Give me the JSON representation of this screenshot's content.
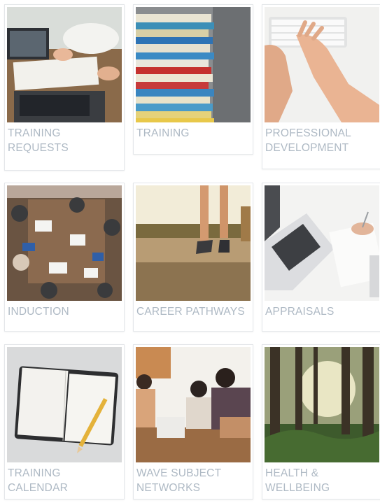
{
  "tiles": [
    {
      "label": "Training\nRequests",
      "image": "laptop-meeting-image"
    },
    {
      "label": "Training",
      "image": "book-stack-image"
    },
    {
      "label": "Professional\nDevelopment",
      "image": "keyboard-typing-image"
    },
    {
      "label": "Induction",
      "image": "group-desk-image"
    },
    {
      "label": "Career Pathways",
      "image": "running-road-image"
    },
    {
      "label": "Appraisals",
      "image": "laptop-notes-image"
    },
    {
      "label": "Training\nCalendar",
      "image": "notebook-pencil-image"
    },
    {
      "label": "Wave Subject\nNetworks",
      "image": "team-meeting-image"
    },
    {
      "label": "Health &\nWellbeing",
      "image": "forest-image"
    }
  ]
}
